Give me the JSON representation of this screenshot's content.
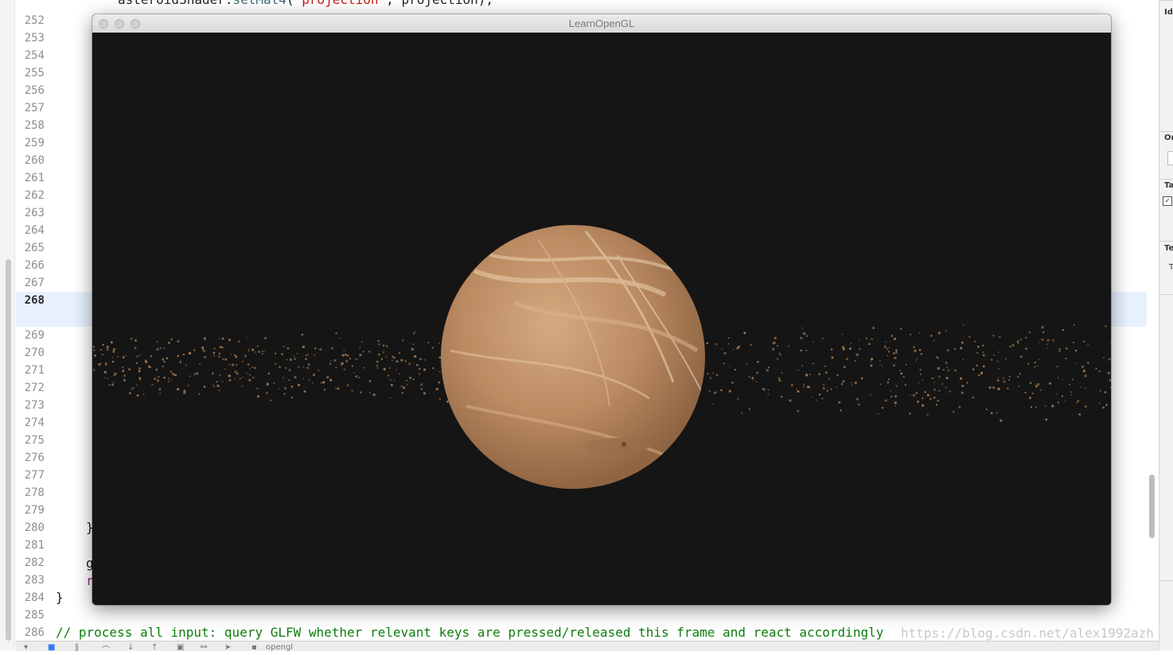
{
  "editor": {
    "line_numbers": [
      "252",
      "253",
      "254",
      "255",
      "256",
      "257",
      "258",
      "259",
      "260",
      "261",
      "262",
      "263",
      "264",
      "265",
      "266",
      "267",
      "268",
      "269",
      "270",
      "271",
      "272",
      "273",
      "274",
      "275",
      "276",
      "277",
      "278",
      "279",
      "280",
      "281",
      "282",
      "283",
      "284",
      "285",
      "286"
    ],
    "active_line": "268",
    "top_code": {
      "prefix": "asteroidShader.",
      "fn": "setMat4",
      "open": "(",
      "str": "\"projection\"",
      "rest": ", projection);"
    },
    "frag_280": "}",
    "frag_282": "g",
    "frag_283": "r",
    "line_284": "}",
    "line_286_comment": "// process all input: query GLFW whether relevant keys are pressed/released this frame and react accordingly",
    "watermark": "https://blog.csdn.net/alex1992azh"
  },
  "gl_window": {
    "title": "LearnOpenGL"
  },
  "inspector": {
    "labels": [
      "Ide",
      "Or",
      "Ta",
      "Te",
      "T"
    ]
  },
  "bottom_bar": {
    "scheme_label": "opengl"
  },
  "colors": {
    "background": "#151515",
    "planet": "#b8865e",
    "asteroid": "#a5784f",
    "line_highlight": "#e8f2ff"
  }
}
